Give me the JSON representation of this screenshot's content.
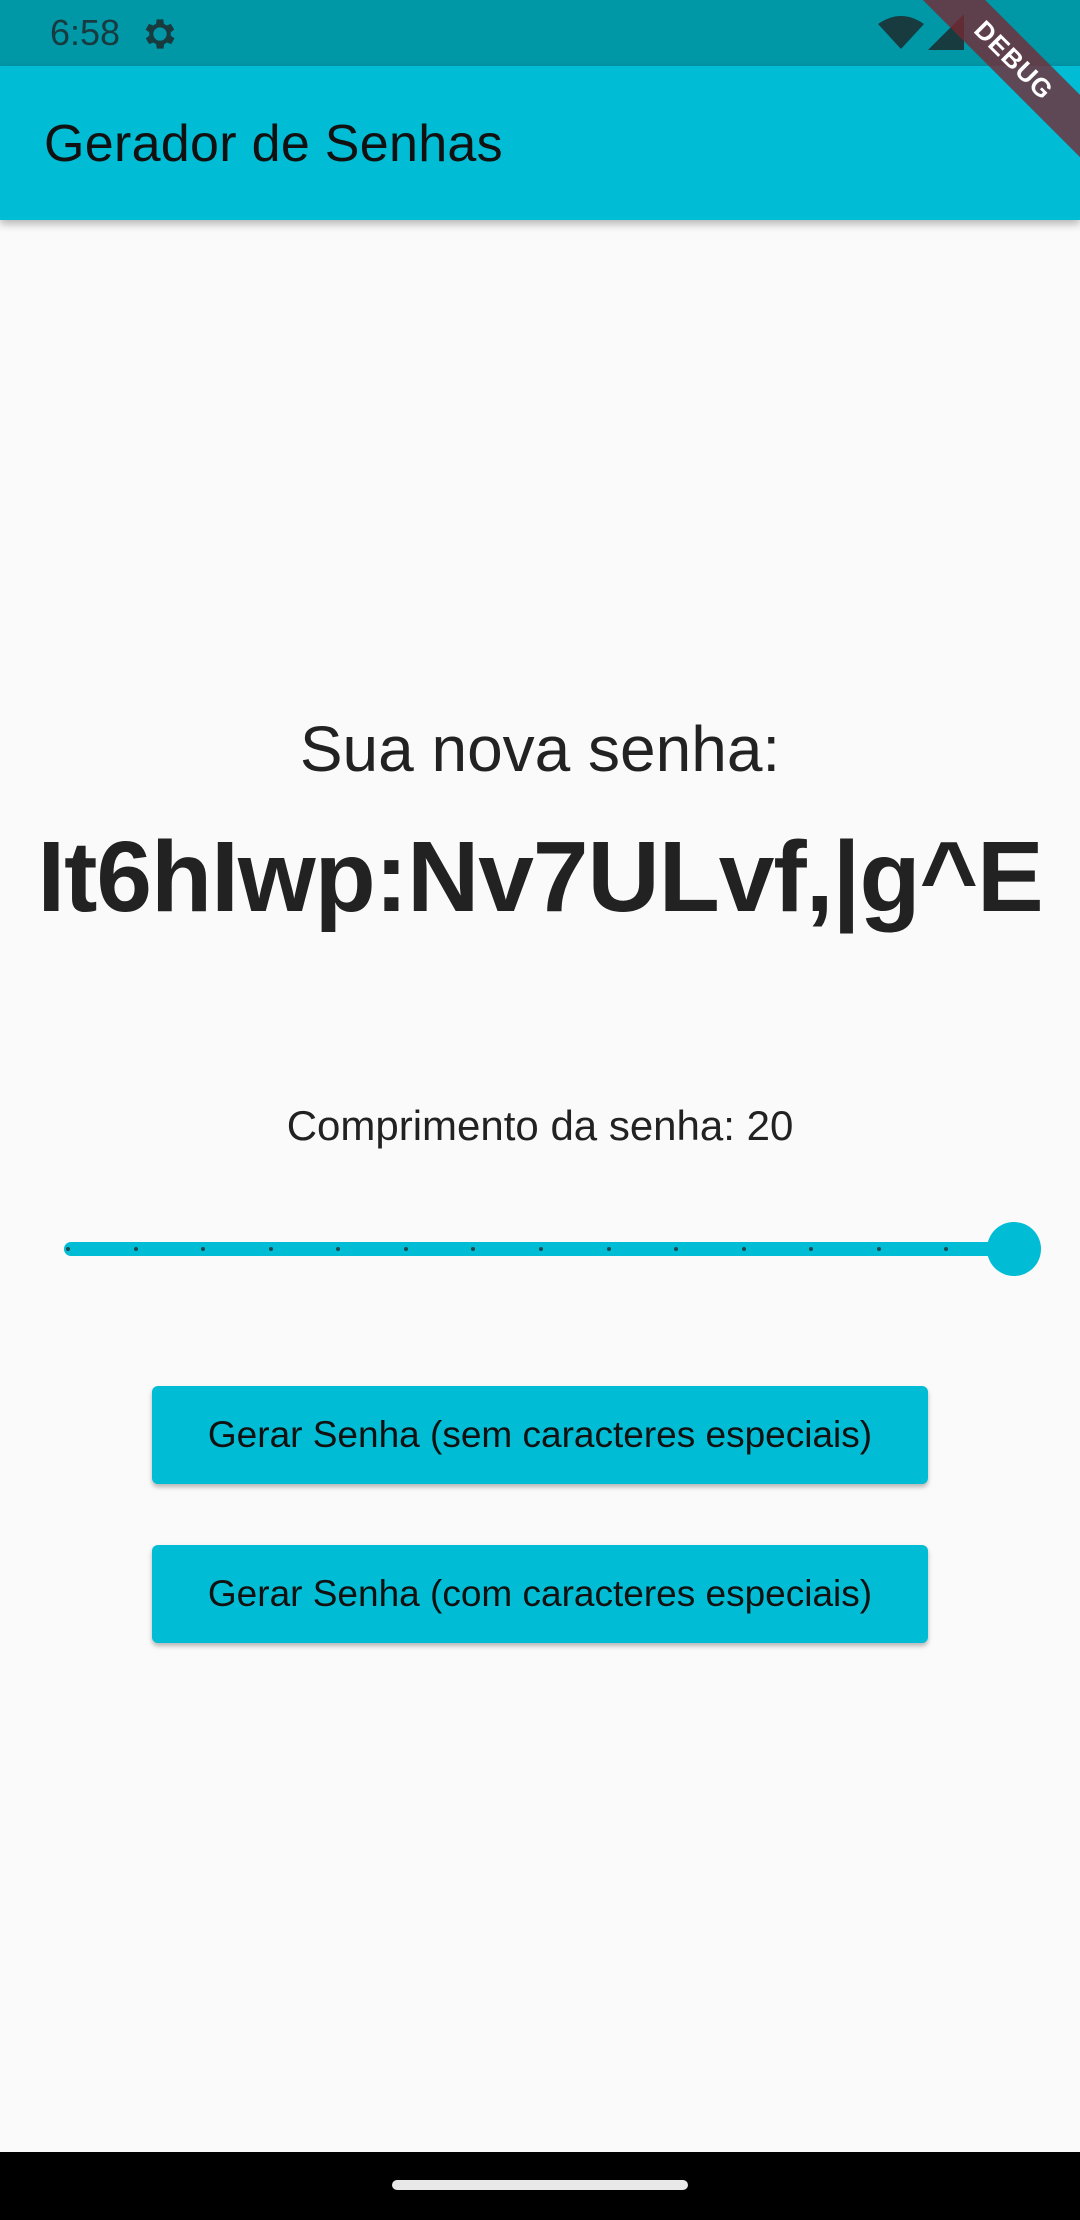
{
  "status_bar": {
    "time": "6:58",
    "gear_icon": "gear-icon",
    "wifi_icon": "wifi-icon",
    "signal_icon": "signal-icon",
    "color": "#0097a7"
  },
  "app_bar": {
    "title": "Gerador de Senhas",
    "color": "#00bcd4"
  },
  "debug_banner": {
    "label": "DEBUG"
  },
  "main": {
    "password_label": "Sua nova senha:",
    "password": "It6hIwp:Nv7ULvf,|g^E",
    "length_label": "Comprimento da senha: 20",
    "slider": {
      "value": 20,
      "max": 20,
      "divisions": 14
    },
    "buttons": {
      "no_special": "Gerar Senha (sem caracteres especiais)",
      "with_special": "Gerar Senha (com caracteres especiais)"
    }
  }
}
